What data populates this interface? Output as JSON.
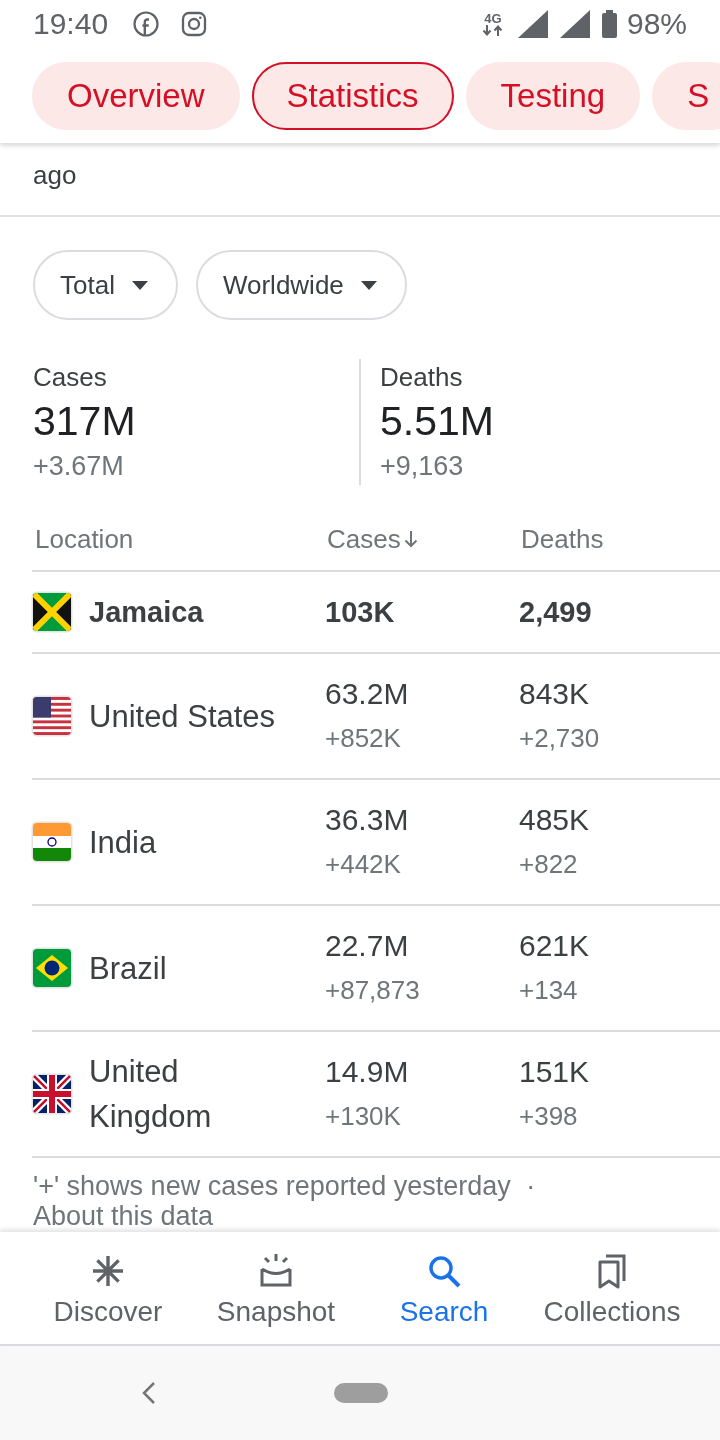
{
  "status_bar": {
    "time": "19:40",
    "network": "4G",
    "battery": "98%"
  },
  "tabs": [
    {
      "label": "Overview",
      "selected": false
    },
    {
      "label": "Statistics",
      "selected": true
    },
    {
      "label": "Testing",
      "selected": false
    },
    {
      "label": "S",
      "selected": false
    }
  ],
  "source": {
    "text": "ago"
  },
  "filters": [
    {
      "label": "Total"
    },
    {
      "label": "Worldwide"
    }
  ],
  "summary": [
    {
      "label": "Cases",
      "value": "317M",
      "change": "+3.67M"
    },
    {
      "label": "Deaths",
      "value": "5.51M",
      "change": "+9,163"
    }
  ],
  "table": {
    "columns": [
      {
        "label": "Location",
        "sorted": false
      },
      {
        "label": "Cases",
        "sorted": true
      },
      {
        "label": "Deaths",
        "sorted": false
      }
    ],
    "rows": [
      {
        "location": "Jamaica",
        "highlighted": true,
        "cases": "103K",
        "deaths": "2,499"
      },
      {
        "location": "United States",
        "highlighted": false,
        "cases": "63.2M",
        "cases_change": "+852K",
        "deaths": "843K",
        "deaths_change": "+2,730"
      },
      {
        "location": "India",
        "highlighted": false,
        "cases": "36.3M",
        "cases_change": "+442K",
        "deaths": "485K",
        "deaths_change": "+822"
      },
      {
        "location": "Brazil",
        "highlighted": false,
        "cases": "22.7M",
        "cases_change": "+87,873",
        "deaths": "621K",
        "deaths_change": "+134"
      },
      {
        "location": "United Kingdom",
        "highlighted": false,
        "cases": "14.9M",
        "cases_change": "+130K",
        "deaths": "151K",
        "deaths_change": "+398"
      }
    ]
  },
  "footnote": {
    "text": "'+' shows new cases reported yesterday",
    "separator": "·",
    "link": "About this data"
  },
  "bottom_nav": [
    {
      "label": "Discover",
      "selected": false
    },
    {
      "label": "Snapshot",
      "selected": false
    },
    {
      "label": "Search",
      "selected": true
    },
    {
      "label": "Collections",
      "selected": false
    }
  ]
}
